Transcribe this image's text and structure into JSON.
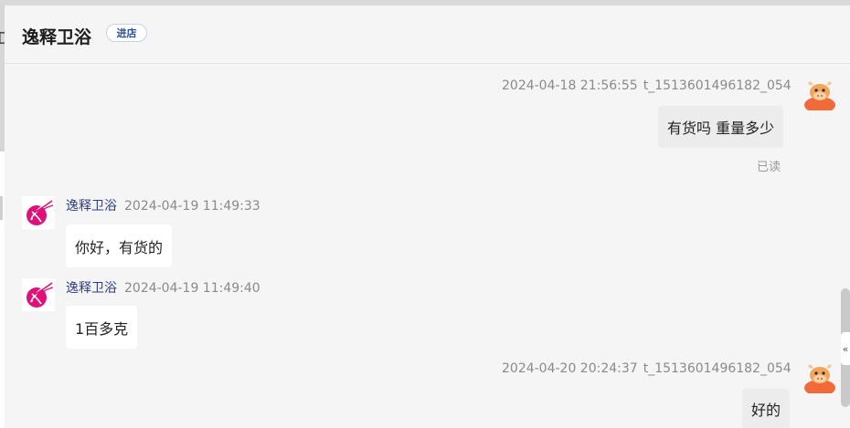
{
  "header": {
    "shop_name": "逸释卫浴",
    "enter_store_label": "进店"
  },
  "messages": [
    {
      "time": "2024-04-18 21:56:55",
      "user": "t_1513601496182_054",
      "text": "有货吗 重量多少",
      "status": "已读"
    },
    {
      "sender": "逸释卫浴",
      "time": "2024-04-19 11:49:33",
      "text": "你好，有货的"
    },
    {
      "sender": "逸释卫浴",
      "time": "2024-04-19 11:49:40",
      "text": "1百多克"
    },
    {
      "time": "2024-04-20 20:24:37",
      "user": "t_1513601496182_054",
      "text": "好的"
    }
  ],
  "background_window": {
    "edge_glyph": "D"
  },
  "side_tab": {
    "icon": "double-chevron-left-icon",
    "glyph": "«"
  },
  "colors": {
    "shop_avatar_accent": "#e0107a",
    "user_avatar_accent": "#f06a3a",
    "sender_name": "#2c3e8c",
    "enter_button_text": "#2a4f94"
  }
}
